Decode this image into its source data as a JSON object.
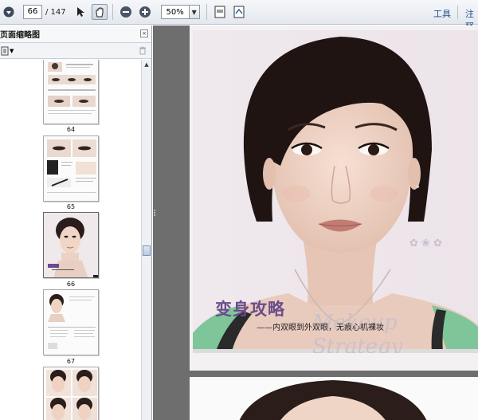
{
  "toolbar": {
    "page_current": "66",
    "page_total": "/ 147",
    "zoom": "50%",
    "tools_label": "工具",
    "comment_label": "注释"
  },
  "sidebar": {
    "title": "页面缩略图",
    "close_glyph": "×",
    "thumbnails": [
      {
        "label": "64"
      },
      {
        "label": "65"
      },
      {
        "label": "66"
      },
      {
        "label": "67"
      }
    ]
  },
  "page": {
    "banner_title": "变身攻略",
    "banner_subtitle": "——内双眼到外双眼，无痕心机裸妆",
    "banner_script": "Makeup Strategy"
  }
}
